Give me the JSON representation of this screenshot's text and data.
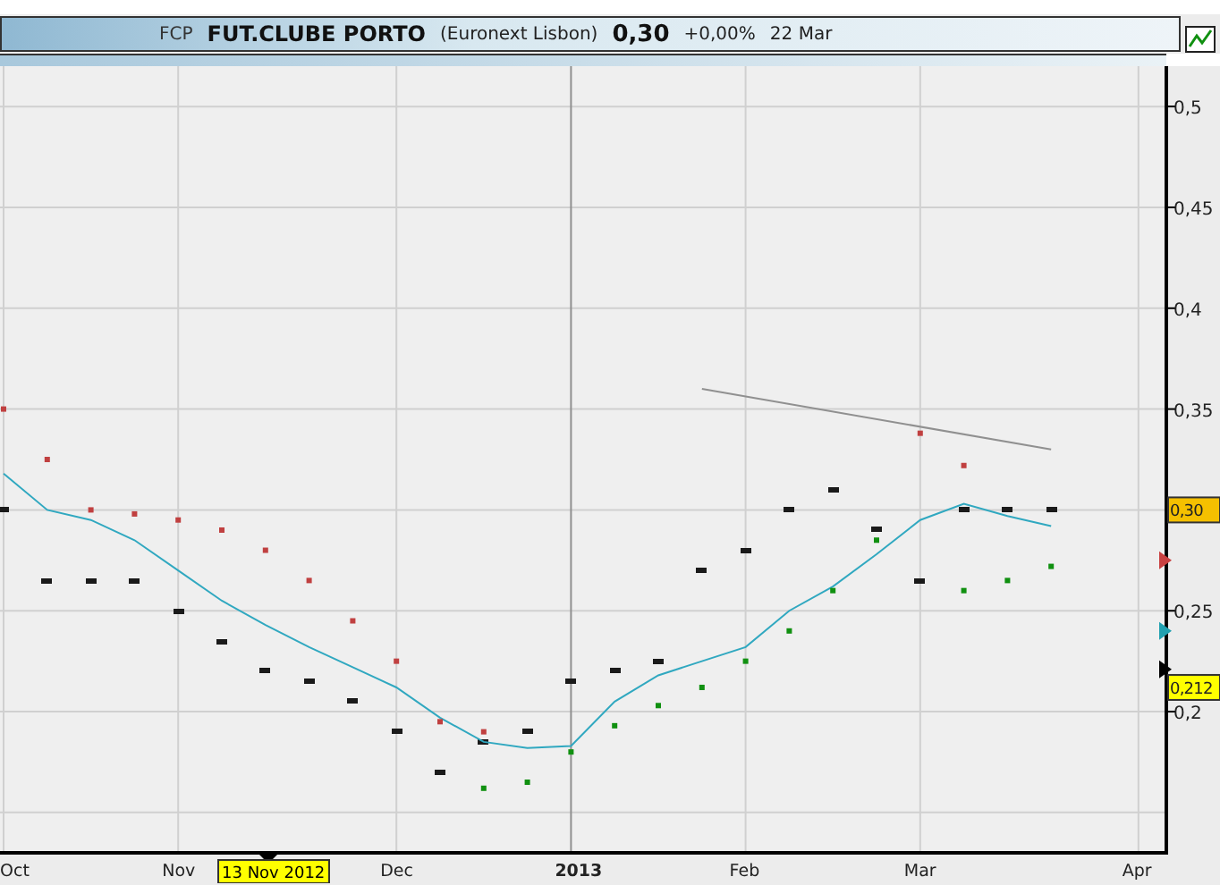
{
  "header": {
    "symbol": "FCP",
    "name": "FUT.CLUBE PORTO",
    "exchange": "(Euronext Lisbon)",
    "price": "0,30",
    "change": "+0,00%",
    "date": "22 Mar"
  },
  "chart": {
    "cursor_date": "13 Nov 2012",
    "price_tags": [
      {
        "label": "0,30",
        "color": "#f5c000"
      },
      {
        "label": "0,212",
        "color": "#ffff00"
      }
    ],
    "markers": [
      {
        "color": "#c84040"
      },
      {
        "color": "#20a0b0"
      },
      {
        "color": "#000000"
      }
    ],
    "chart_data": {
      "type": "line",
      "categories": [
        "Oct",
        null,
        null,
        null,
        "Nov",
        null,
        null,
        null,
        null,
        "Dec",
        null,
        null,
        null,
        "2013",
        null,
        null,
        null,
        "Feb",
        null,
        null,
        null,
        "Mar",
        null,
        null,
        null,
        null,
        "Apr"
      ],
      "yticks": [
        {
          "value": 0.5,
          "label": "0,5"
        },
        {
          "value": 0.45,
          "label": "0,45"
        },
        {
          "value": 0.4,
          "label": "0,4"
        },
        {
          "value": 0.35,
          "label": "0,35"
        },
        {
          "value": 0.25,
          "label": "0,25"
        },
        {
          "value": 0.2,
          "label": "0,2"
        }
      ],
      "ylim": [
        0.13,
        0.52
      ],
      "grid": true,
      "series": [
        {
          "type": "scatter",
          "color": "#1a1a1a",
          "values": [
            0.3,
            0.265,
            0.265,
            0.265,
            0.25,
            0.235,
            0.22,
            0.215,
            0.205,
            0.19,
            0.17,
            0.185,
            0.19,
            0.215,
            0.22,
            0.225,
            0.27,
            0.28,
            0.3,
            0.31,
            0.29,
            0.265,
            0.3,
            0.3,
            0.3,
            null,
            null
          ]
        },
        {
          "type": "line",
          "color": "#30a8c0",
          "values": [
            0.318,
            0.3,
            0.295,
            0.285,
            0.27,
            0.255,
            0.243,
            0.232,
            0.222,
            0.212,
            0.197,
            0.185,
            0.182,
            0.183,
            0.205,
            0.218,
            0.225,
            0.232,
            0.25,
            0.262,
            0.278,
            0.295,
            0.303,
            0.297,
            0.292,
            null,
            null
          ]
        },
        {
          "type": "scatter",
          "marker": "square",
          "color": "#c04040",
          "values": [
            0.35,
            0.325,
            0.3,
            0.298,
            0.295,
            0.29,
            0.28,
            0.265,
            0.245,
            0.225,
            0.195,
            0.19,
            null,
            null,
            null,
            null,
            null,
            null,
            null,
            null,
            null,
            0.338,
            0.322,
            null,
            null,
            null,
            null
          ]
        },
        {
          "type": "scatter",
          "marker": "square",
          "color": "#109010",
          "values": [
            null,
            null,
            null,
            null,
            null,
            null,
            null,
            null,
            null,
            null,
            null,
            0.162,
            0.165,
            0.18,
            0.193,
            0.203,
            0.212,
            0.225,
            0.24,
            0.26,
            0.285,
            null,
            0.26,
            0.265,
            0.272,
            null,
            null
          ]
        },
        {
          "type": "line",
          "color": "#909090",
          "values": [
            null,
            null,
            null,
            null,
            null,
            null,
            null,
            null,
            null,
            null,
            null,
            null,
            null,
            null,
            null,
            null,
            0.36,
            null,
            null,
            null,
            null,
            null,
            null,
            null,
            0.33,
            null,
            null
          ]
        }
      ]
    }
  }
}
